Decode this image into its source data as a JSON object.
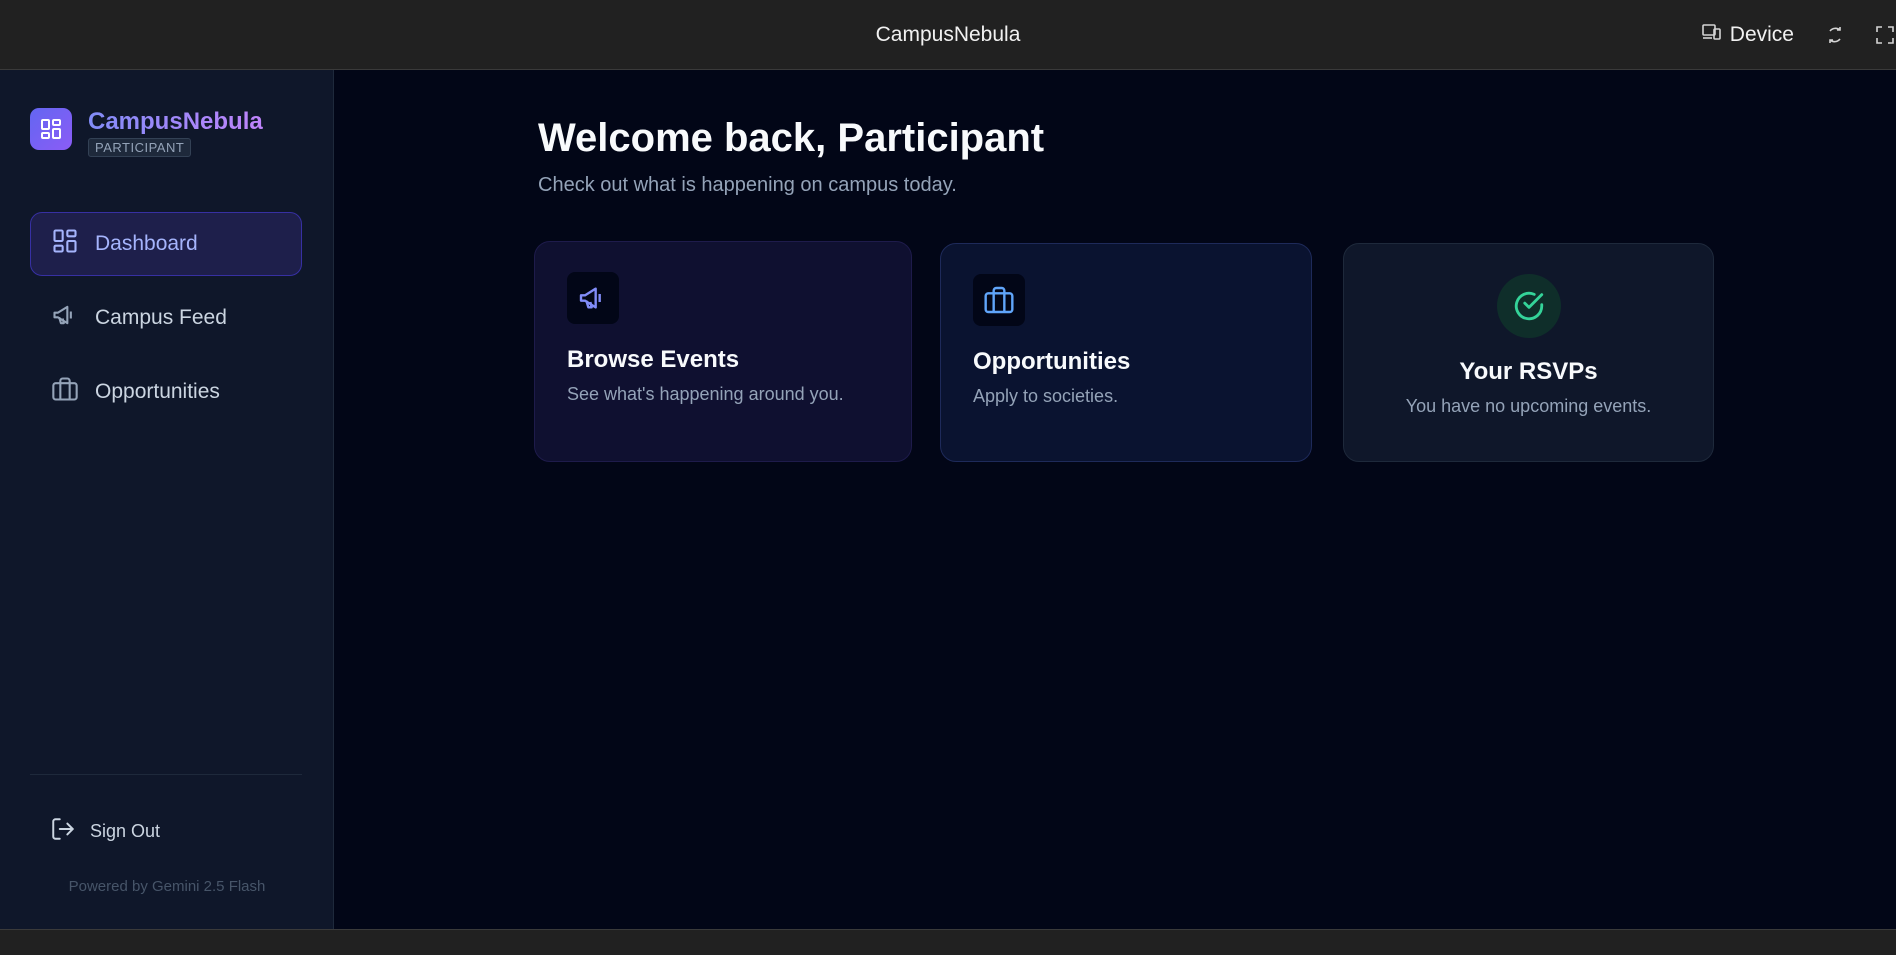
{
  "topbar": {
    "title": "CampusNebula",
    "device_label": "Device",
    "icons": [
      "device-icon",
      "rotate-icon",
      "fullscreen-icon"
    ]
  },
  "sidebar": {
    "brand_name": "CampusNebula",
    "role_badge": "PARTICIPANT",
    "items": [
      {
        "label": "Dashboard",
        "icon": "dashboard-icon",
        "active": true
      },
      {
        "label": "Campus Feed",
        "icon": "megaphone-icon",
        "active": false
      },
      {
        "label": "Opportunities",
        "icon": "briefcase-icon",
        "active": false
      }
    ],
    "sign_out_label": "Sign Out",
    "powered_by": "Powered by Gemini 2.5 Flash"
  },
  "main": {
    "welcome": "Welcome back, Participant",
    "subtitle": "Check out what is happening on campus today.",
    "cards": [
      {
        "title": "Browse Events",
        "desc": "See what's happening around you.",
        "icon": "megaphone-icon"
      },
      {
        "title": "Opportunities",
        "desc": "Apply to societies.",
        "icon": "briefcase-icon"
      },
      {
        "title": "Your RSVPs",
        "desc": "You have no upcoming events.",
        "icon": "check-circle-icon"
      }
    ]
  },
  "colors": {
    "accent": "#818cf8",
    "accent_purple": "#c084fc",
    "success": "#34d399",
    "background": "#020617",
    "sidebar": "#0f172a"
  }
}
